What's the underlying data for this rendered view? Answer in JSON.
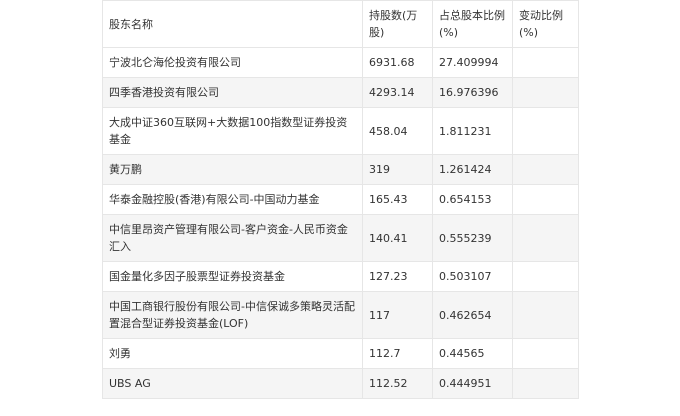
{
  "table": {
    "headers": [
      "股东名称",
      "持股数(万股)",
      "占总股本比例(%)",
      "变动比例(%)"
    ],
    "rows": [
      [
        "宁波北仑海伦投资有限公司",
        "6931.68",
        "27.409994",
        ""
      ],
      [
        "四季香港投资有限公司",
        "4293.14",
        "16.976396",
        ""
      ],
      [
        "大成中证360互联网+大数据100指数型证券投资基金",
        "458.04",
        "1.811231",
        ""
      ],
      [
        "黄万鹏",
        "319",
        "1.261424",
        ""
      ],
      [
        "华泰金融控股(香港)有限公司-中国动力基金",
        "165.43",
        "0.654153",
        ""
      ],
      [
        "中信里昂资产管理有限公司-客户资金-人民币资金汇入",
        "140.41",
        "0.555239",
        ""
      ],
      [
        "国金量化多因子股票型证券投资基金",
        "127.23",
        "0.503107",
        ""
      ],
      [
        "中国工商银行股份有限公司-中信保诚多策略灵活配置混合型证券投资基金(LOF)",
        "117",
        "0.462654",
        ""
      ],
      [
        "刘勇",
        "112.7",
        "0.44565",
        ""
      ],
      [
        "UBS AG",
        "112.52",
        "0.444951",
        ""
      ]
    ]
  }
}
